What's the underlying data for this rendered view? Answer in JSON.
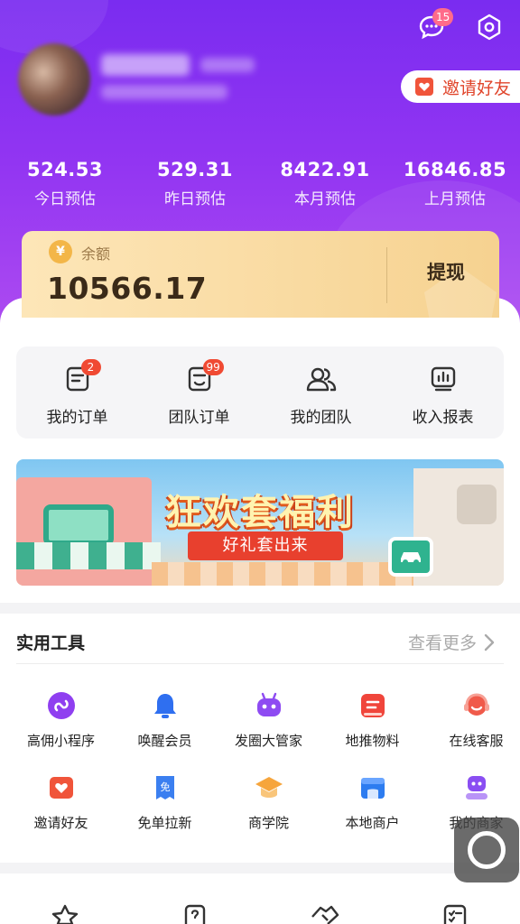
{
  "header": {
    "message_badge": "15",
    "icons": [
      "message-icon",
      "settings-icon"
    ],
    "invite_label": "邀请好友"
  },
  "stats": [
    {
      "value": "524.53",
      "label": "今日预估"
    },
    {
      "value": "529.31",
      "label": "昨日预估"
    },
    {
      "value": "8422.91",
      "label": "本月预估"
    },
    {
      "value": "16846.85",
      "label": "上月预估"
    }
  ],
  "balance": {
    "label": "余额",
    "amount": "10566.17",
    "withdraw_label": "提现"
  },
  "quick_menu": [
    {
      "label": "我的订单",
      "badge": "2",
      "icon": "order-icon"
    },
    {
      "label": "团队订单",
      "badge": "99",
      "icon": "team-order-icon"
    },
    {
      "label": "我的团队",
      "badge": "",
      "icon": "team-icon"
    },
    {
      "label": "收入报表",
      "badge": "",
      "icon": "report-icon"
    }
  ],
  "banner": {
    "title": "狂欢套福利",
    "subtitle": "好礼套出来"
  },
  "tools": {
    "title": "实用工具",
    "more_label": "查看更多",
    "items": [
      {
        "label": "高佣小程序",
        "icon": "mini-program-icon",
        "color": "#8f3ff0"
      },
      {
        "label": "唤醒会员",
        "icon": "bell-icon",
        "color": "#2f6ff0"
      },
      {
        "label": "发圈大管家",
        "icon": "robot-icon",
        "color": "#8e4bf2"
      },
      {
        "label": "地推物料",
        "icon": "material-icon",
        "color": "#f0453b"
      },
      {
        "label": "在线客服",
        "icon": "headset-icon",
        "color": "#f05a4a"
      },
      {
        "label": "邀请好友",
        "icon": "invite-icon",
        "color": "#f0543a"
      },
      {
        "label": "免单拉新",
        "icon": "free-ticket-icon",
        "color": "#3b7ff0"
      },
      {
        "label": "商学院",
        "icon": "graduation-cap-icon",
        "color": "#f6a53c"
      },
      {
        "label": "本地商户",
        "icon": "local-store-icon",
        "color": "#2d7cf0"
      },
      {
        "label": "我的商家",
        "icon": "merchant-icon",
        "color": "#8a4ef2"
      }
    ]
  },
  "colors": {
    "hero_top": "#7a2cf0",
    "hero_bottom": "#b24ff0",
    "accent_red": "#e0452b",
    "balance_gold": "#f6d290"
  }
}
